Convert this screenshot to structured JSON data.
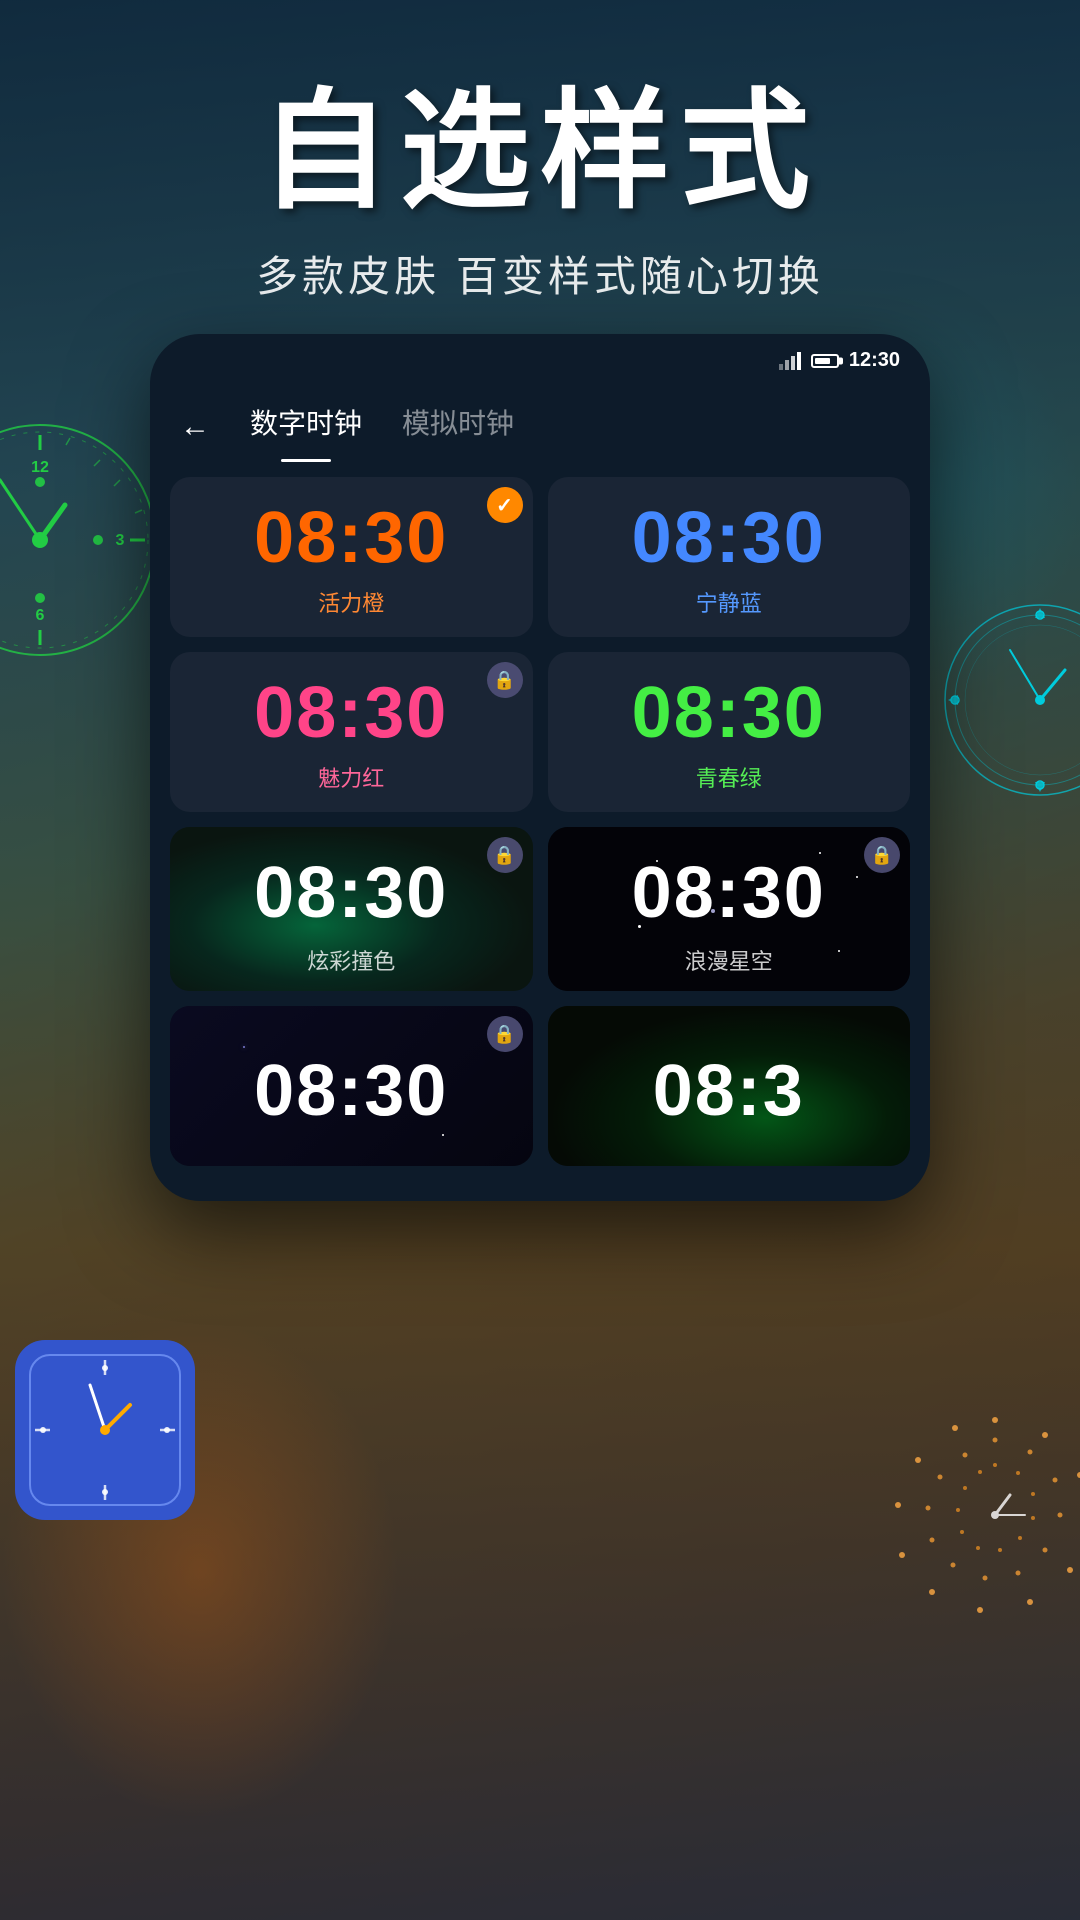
{
  "header": {
    "title": "自选样式",
    "subtitle": "多款皮肤 百变样式随心切换"
  },
  "statusBar": {
    "time": "12:30",
    "batteryLabel": "battery"
  },
  "tabs": {
    "digital": "数字时钟",
    "analog": "模拟时钟"
  },
  "backArrow": "←",
  "clockStyles": [
    {
      "id": "orange",
      "time": "08:30",
      "label": "活力橙",
      "color": "orange",
      "selected": true,
      "locked": false
    },
    {
      "id": "blue",
      "time": "08:30",
      "label": "宁静蓝",
      "color": "blue",
      "selected": false,
      "locked": false
    },
    {
      "id": "pink",
      "time": "08:30",
      "label": "魅力红",
      "color": "pink",
      "selected": false,
      "locked": true
    },
    {
      "id": "green",
      "time": "08:30",
      "label": "青春绿",
      "color": "green",
      "selected": false,
      "locked": false
    },
    {
      "id": "nebula",
      "time": "08:30",
      "label": "炫彩撞色",
      "color": "white",
      "selected": false,
      "locked": true,
      "hasBg": true,
      "bgType": "nebula"
    },
    {
      "id": "space",
      "time": "08:30",
      "label": "浪漫星空",
      "color": "white",
      "selected": false,
      "locked": true,
      "hasBg": true,
      "bgType": "space"
    },
    {
      "id": "stars1",
      "time": "08:30",
      "label": "",
      "color": "white",
      "selected": false,
      "locked": true,
      "hasBg": true,
      "bgType": "dark-stars"
    },
    {
      "id": "stars2",
      "time": "08:3",
      "label": "",
      "color": "white",
      "selected": false,
      "locked": false,
      "hasBg": true,
      "bgType": "green-glow"
    }
  ],
  "decoClocks": {
    "greenAnalog": "analog-green",
    "cyanAnalog": "analog-cyan",
    "blueSquare": "square-blue",
    "spiralDot": "spiral-dots"
  },
  "colors": {
    "orange": "#ff6600",
    "blue": "#4488ff",
    "pink": "#ff4488",
    "green": "#44ee44",
    "white": "#ffffff",
    "orangeLabel": "#ff8833",
    "blueLabel": "#5599ff",
    "pinkLabel": "#ff6699",
    "greenLabel": "#55ee55",
    "checkBadge": "#ff8800",
    "lockBadge": "#505080",
    "cardBg": "#1a2a3a"
  }
}
